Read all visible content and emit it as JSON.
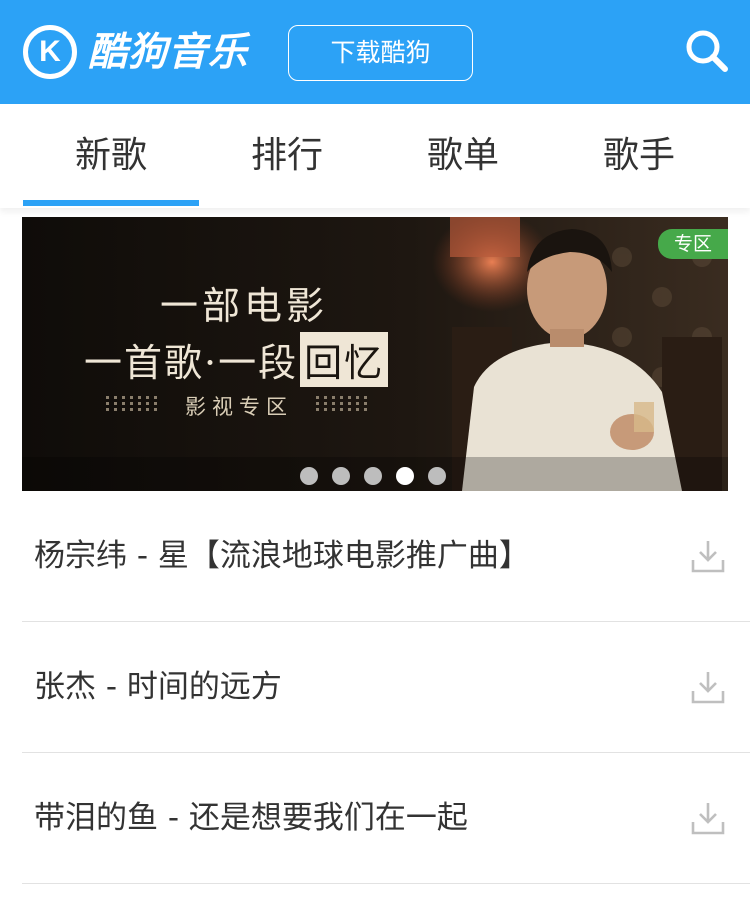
{
  "header": {
    "logo_letter": "K",
    "app_name": "酷狗音乐",
    "download_label": "下载酷狗",
    "search_icon": "search-icon",
    "background_color": "#2ca2f6"
  },
  "tabs": [
    {
      "label": "新歌",
      "active": true
    },
    {
      "label": "排行",
      "active": false
    },
    {
      "label": "歌单",
      "active": false
    },
    {
      "label": "歌手",
      "active": false
    }
  ],
  "banner": {
    "line1": "一部电影",
    "line2_prefix": "一首歌·一段",
    "line2_boxed": "回忆",
    "line3": "影视专区",
    "badge": "专区",
    "badge_color": "#46a94a",
    "dots_total": 5,
    "active_dot": 4
  },
  "songs": [
    {
      "title": "杨宗纬 - 星【流浪地球电影推广曲】",
      "icon": "download-icon"
    },
    {
      "title": "张杰 - 时间的远方",
      "icon": "download-icon"
    },
    {
      "title": "带泪的鱼 - 还是想要我们在一起",
      "icon": "download-icon"
    }
  ]
}
